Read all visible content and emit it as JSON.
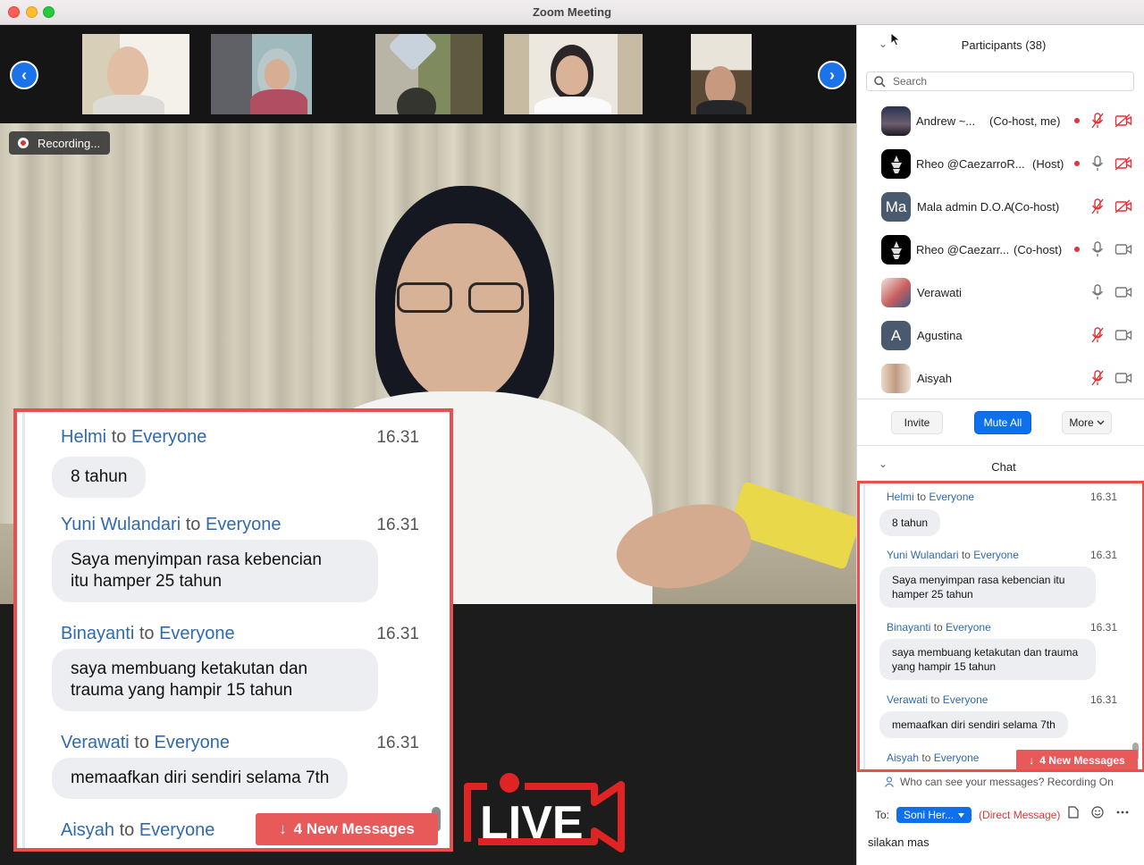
{
  "window": {
    "title": "Zoom Meeting"
  },
  "video": {
    "recording_label": "Recording...",
    "live_label": "LIVE",
    "prev_arrow": "‹",
    "next_arrow": "›"
  },
  "participants": {
    "title": "Participants (38)",
    "search_placeholder": "Search",
    "items": [
      {
        "name": "Andrew ~...",
        "role": "(Co-host, me)",
        "recording": true,
        "mic": "muted",
        "camera": "off"
      },
      {
        "name": "Rheo @CaezarroR...",
        "role": "(Host)",
        "recording": true,
        "mic": "on",
        "camera": "off"
      },
      {
        "name": "Mala admin D.O.A",
        "role": "(Co-host)",
        "avatar_initials": "Ma",
        "recording": false,
        "mic": "muted",
        "camera": "off"
      },
      {
        "name": "Rheo @Caezarr...",
        "role": "(Co-host)",
        "recording": true,
        "mic": "on",
        "camera": "on"
      },
      {
        "name": "Verawati",
        "role": "",
        "recording": false,
        "mic": "on",
        "camera": "on"
      },
      {
        "name": "Agustina",
        "role": "",
        "avatar_initials": "A",
        "recording": false,
        "mic": "muted",
        "camera": "on"
      },
      {
        "name": "Aisyah",
        "role": "",
        "recording": false,
        "mic": "muted",
        "camera": "on"
      }
    ],
    "invite_label": "Invite",
    "mute_all_label": "Mute All",
    "more_label": "More"
  },
  "chat": {
    "title": "Chat",
    "to_word": "to",
    "messages": [
      {
        "sender": "Helmi",
        "recipient": "Everyone",
        "time": "16.31",
        "text": "8 tahun"
      },
      {
        "sender": "Yuni Wulandari",
        "recipient": "Everyone",
        "time": "16.31",
        "text": "Saya menyimpan rasa kebencian itu hamper 25 tahun"
      },
      {
        "sender": "Binayanti",
        "recipient": "Everyone",
        "time": "16.31",
        "text": "saya membuang ketakutan dan trauma yang hampir 15 tahun"
      },
      {
        "sender": "Verawati",
        "recipient": "Everyone",
        "time": "16.31",
        "text": "memaafkan diri sendiri selama 7th"
      },
      {
        "sender": "Aisyah",
        "recipient": "Everyone",
        "time": "",
        "text": ""
      }
    ],
    "zoom_bubble_lines": {
      "m1": [
        "Saya menyimpan rasa kebencian",
        "itu hamper 25 tahun"
      ],
      "m2": [
        "saya membuang ketakutan dan",
        "trauma yang hampir 15 tahun"
      ]
    },
    "new_messages_label": "4 New Messages",
    "privacy_note": "Who can see your messages? Recording On",
    "to_label": "To:",
    "recipient_select": "Soni Her...",
    "direct_message_label": "(Direct Message)",
    "input_value": "silakan mas"
  },
  "colors": {
    "accent": "#0e71eb",
    "highlight_border": "#e85050",
    "sender_blue": "#2f6ab0",
    "recording_red": "#e0343a"
  }
}
